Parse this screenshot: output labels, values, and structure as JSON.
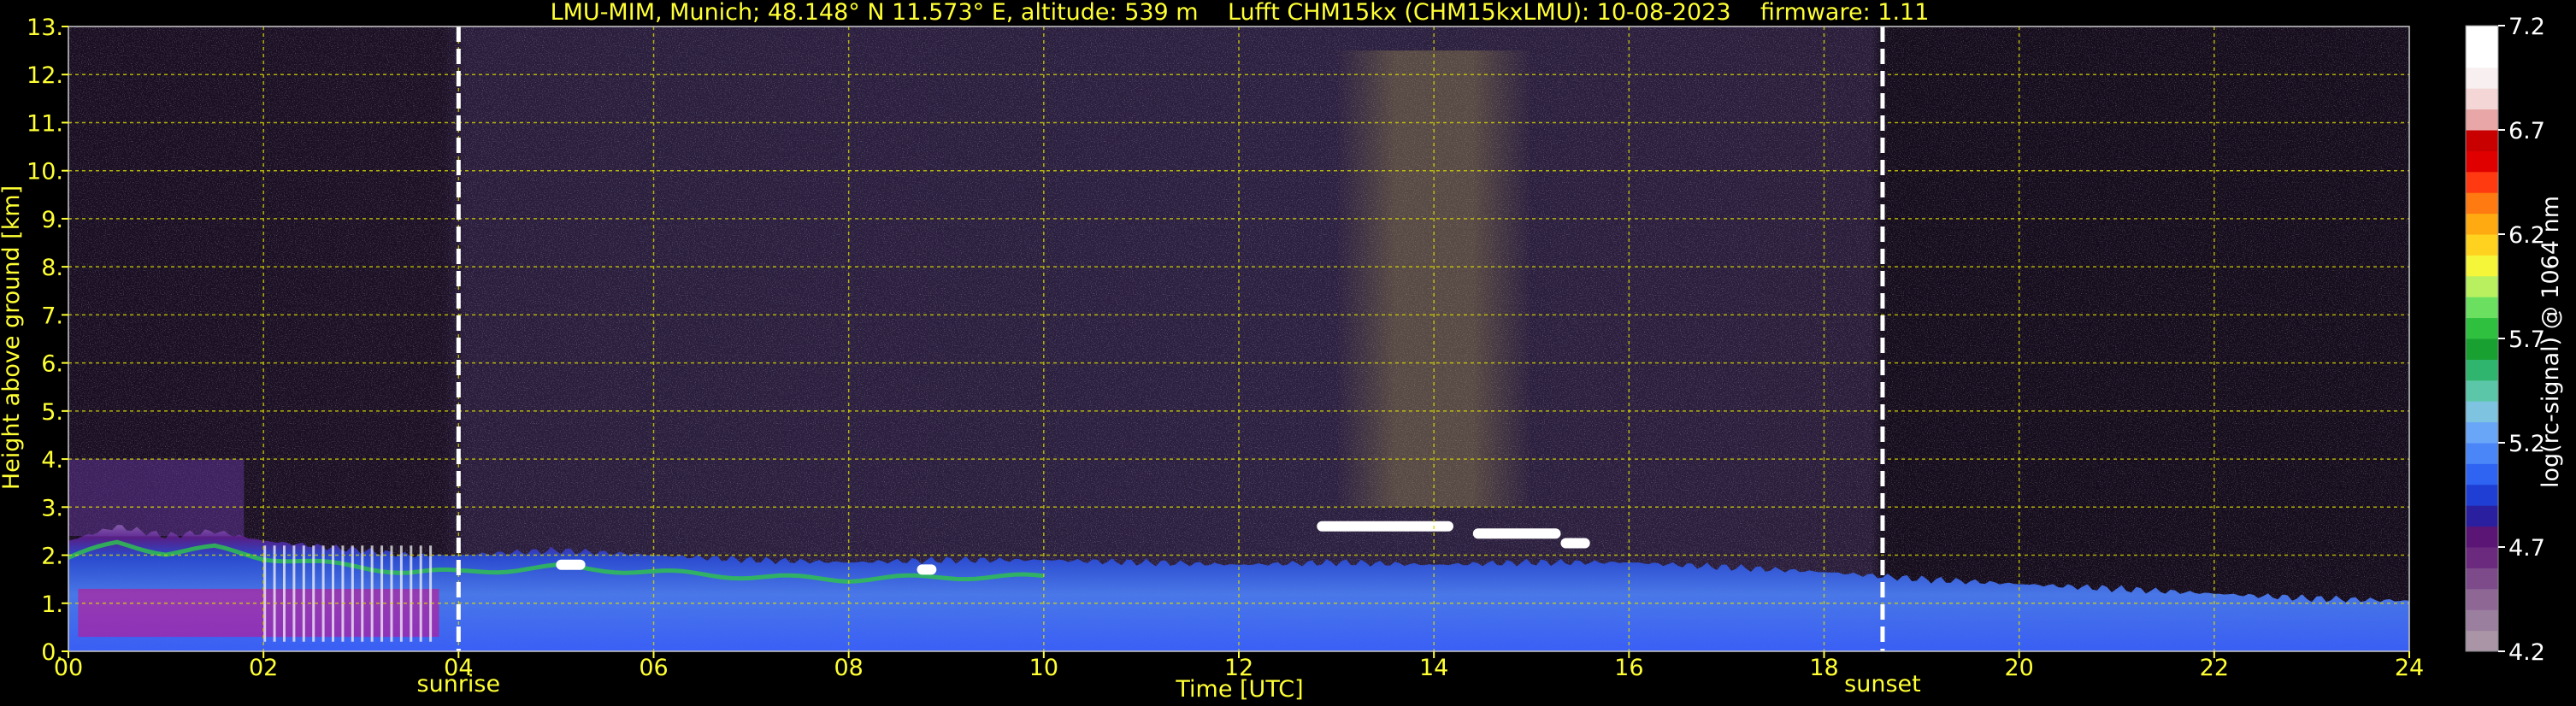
{
  "chart_data": {
    "type": "heatmap",
    "title": "LMU-MIM, Munich; 48.148° N 11.573° E, altitude: 539 m    Lufft CHM15kx (CHM15kxLMU): 10-08-2023    firmware: 1.11",
    "xlabel": "Time [UTC]",
    "ylabel": "Height above ground [km]",
    "xlim": [
      0,
      24
    ],
    "ylim": [
      0,
      13
    ],
    "x_ticks": [
      "00",
      "02",
      "04",
      "06",
      "08",
      "10",
      "12",
      "14",
      "16",
      "18",
      "20",
      "22",
      "24"
    ],
    "y_ticks": [
      "0.",
      "1.",
      "2.",
      "3.",
      "4.",
      "5.",
      "6.",
      "7.",
      "8.",
      "9.",
      "10.",
      "11.",
      "12.",
      "13."
    ],
    "grid": true,
    "markers": [
      {
        "label": "sunrise",
        "x": 4.0
      },
      {
        "label": "sunset",
        "x": 18.6
      }
    ],
    "colorbar": {
      "label": "log(rc-signal) @ 1064 nm",
      "range": [
        4.2,
        7.2
      ],
      "ticks": [
        "7.2",
        "6.7",
        "6.2",
        "5.7",
        "5.2",
        "4.7",
        "4.2"
      ],
      "colors": [
        "#a995a5",
        "#9b7f9e",
        "#8e6795",
        "#7d4b8a",
        "#6b2a7e",
        "#5a1575",
        "#2a1f9e",
        "#1f3fd4",
        "#2f63f2",
        "#4a86f7",
        "#6aa6f7",
        "#7ec3e0",
        "#5cc7a8",
        "#2fb56e",
        "#18a030",
        "#2fc040",
        "#6be060",
        "#b8f060",
        "#f5f53a",
        "#ffd21f",
        "#ffaa11",
        "#ff7a11",
        "#ff3a11",
        "#e00000",
        "#c80000",
        "#e8a6a6",
        "#f4d6d6",
        "#f8f0f0",
        "#ffffff",
        "#ffffff"
      ]
    },
    "layers": {
      "boundary_layer_top_km": [
        [
          0,
          2.3
        ],
        [
          0.5,
          2.6
        ],
        [
          1,
          2.4
        ],
        [
          1.5,
          2.5
        ],
        [
          2,
          2.3
        ],
        [
          2.5,
          2.2
        ],
        [
          3,
          2.1
        ],
        [
          3.5,
          2.0
        ],
        [
          4,
          2.0
        ],
        [
          5,
          2.1
        ],
        [
          6,
          2.0
        ],
        [
          7,
          1.9
        ],
        [
          8,
          1.85
        ],
        [
          9,
          1.9
        ],
        [
          10,
          1.9
        ],
        [
          11,
          1.85
        ],
        [
          12,
          1.8
        ],
        [
          13,
          1.85
        ],
        [
          14,
          1.8
        ],
        [
          15,
          1.85
        ],
        [
          16,
          1.85
        ],
        [
          17,
          1.75
        ],
        [
          18,
          1.65
        ],
        [
          19,
          1.5
        ],
        [
          20,
          1.4
        ],
        [
          21,
          1.3
        ],
        [
          22,
          1.2
        ],
        [
          23,
          1.1
        ],
        [
          24,
          1.05
        ]
      ],
      "cloud_segments": [
        {
          "t0": 12.8,
          "t1": 14.2,
          "h": 2.6
        },
        {
          "t0": 14.4,
          "t1": 15.3,
          "h": 2.45
        },
        {
          "t0": 15.3,
          "t1": 15.6,
          "h": 2.25
        },
        {
          "t0": 5.0,
          "t1": 5.3,
          "h": 1.8
        },
        {
          "t0": 8.7,
          "t1": 8.9,
          "h": 1.7
        }
      ],
      "high_signal_band": {
        "t0": 13.0,
        "t1": 15.0,
        "h0": 3.0,
        "h1": 12.5
      }
    }
  }
}
